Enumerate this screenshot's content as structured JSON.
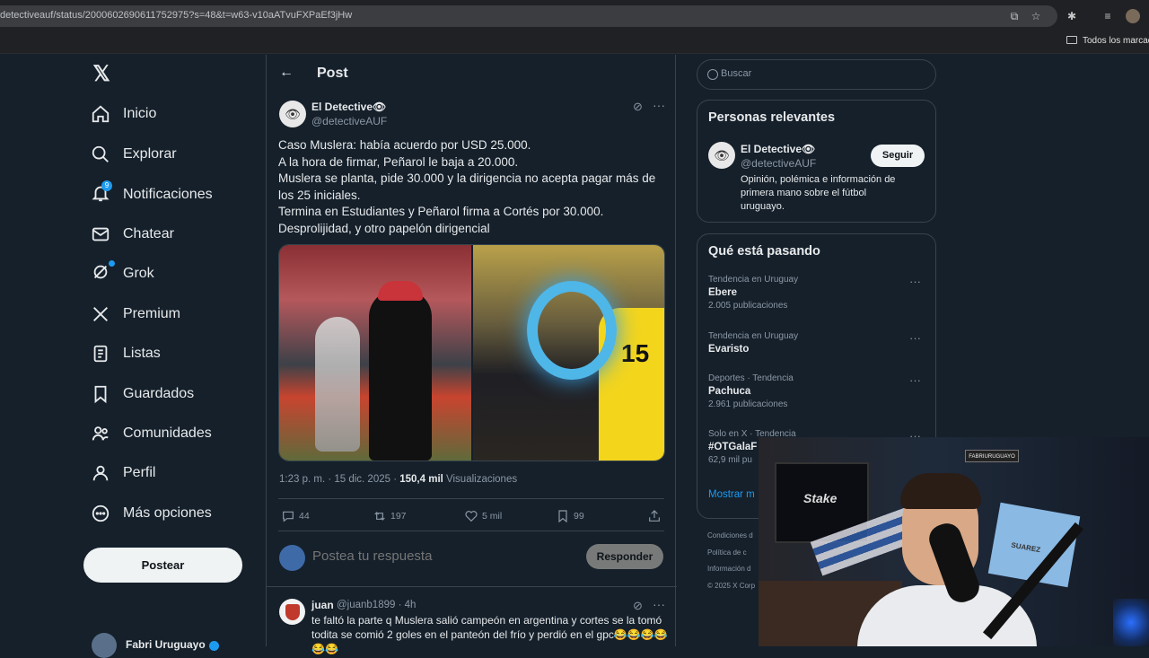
{
  "browser": {
    "url": "detectiveauf/status/2000602690611752975?s=48&t=w63-v10aATvuFXPaEf3jHw",
    "bookmarks_label": "Todos los marcado"
  },
  "sidebar": {
    "items": [
      {
        "label": "Inicio",
        "icon": "home-icon"
      },
      {
        "label": "Explorar",
        "icon": "search-icon"
      },
      {
        "label": "Notificaciones",
        "icon": "bell-icon",
        "badge": "9"
      },
      {
        "label": "Chatear",
        "icon": "mail-icon"
      },
      {
        "label": "Grok",
        "icon": "grok-icon"
      },
      {
        "label": "Premium",
        "icon": "x-icon"
      },
      {
        "label": "Listas",
        "icon": "list-icon"
      },
      {
        "label": "Guardados",
        "icon": "bookmark-icon"
      },
      {
        "label": "Comunidades",
        "icon": "people-icon"
      },
      {
        "label": "Perfil",
        "icon": "person-icon"
      },
      {
        "label": "Más opciones",
        "icon": "more-circle-icon"
      }
    ],
    "post_button": "Postear",
    "account_name": "Fabri Uruguayo"
  },
  "main": {
    "header_title": "Post",
    "tweet": {
      "name": "El Detective👁",
      "handle": "@detectiveAUF",
      "lines": [
        "Caso Muslera: había acuerdo por USD 25.000.",
        "A la hora de firmar, Peñarol le baja a 20.000.",
        "Muslera se planta, pide 30.000 y la dirigencia no acepta pagar más de",
        "los 25 iniciales.",
        "Termina en Estudiantes y Peñarol firma a Cortés por 30.000.",
        "Desprolijidad, y otro papelón dirigencial"
      ],
      "timestamp": "1:23 p. m. · 15 dic. 2025 · ",
      "views_count": "150,4 mil",
      "views_label": " Visualizaciones",
      "replies": "44",
      "reposts": "197",
      "likes": "5 mil",
      "bookmarks": "99",
      "jersey_number": "15"
    },
    "reply_placeholder": "Postea tu respuesta",
    "reply_button": "Responder",
    "first_reply": {
      "name": "juan",
      "handle": "@juanb1899 · 4h",
      "lines": [
        "te faltó la parte q Muslera salió campeón en argentina y cortes se la tomó",
        "todita se comió 2 goles en el panteón del frío y perdió en el gpc😂😂😂😂",
        "😂😂"
      ]
    }
  },
  "right": {
    "search_placeholder": "Buscar",
    "relevant_title": "Personas relevantes",
    "relevant": {
      "name": "El Detective👁",
      "handle": "@detectiveAUF",
      "follow": "Seguir",
      "bio": [
        "Opinión, polémica e información de",
        "primera mano sobre el fútbol",
        "uruguayo."
      ]
    },
    "trends_title": "Qué está pasando",
    "trends": [
      {
        "context": "Tendencia en Uruguay",
        "name": "Ebere",
        "count": "2.005 publicaciones"
      },
      {
        "context": "Tendencia en Uruguay",
        "name": "Evaristo",
        "count": ""
      },
      {
        "context": "Deportes · Tendencia",
        "name": "Pachuca",
        "count": "2.961 publicaciones"
      },
      {
        "context": "Solo en X · Tendencia",
        "name": "#OTGalaF",
        "count": "62,9 mil pu"
      }
    ],
    "show_more": "Mostrar m",
    "footer": [
      "Condiciones d",
      "Política de c",
      "Información d",
      "© 2025 X Corp"
    ]
  },
  "webcam": {
    "monitor_text": "Stake",
    "sign_text": "FABRIURUGUAYO",
    "shirt_text": "SUAREZ"
  }
}
